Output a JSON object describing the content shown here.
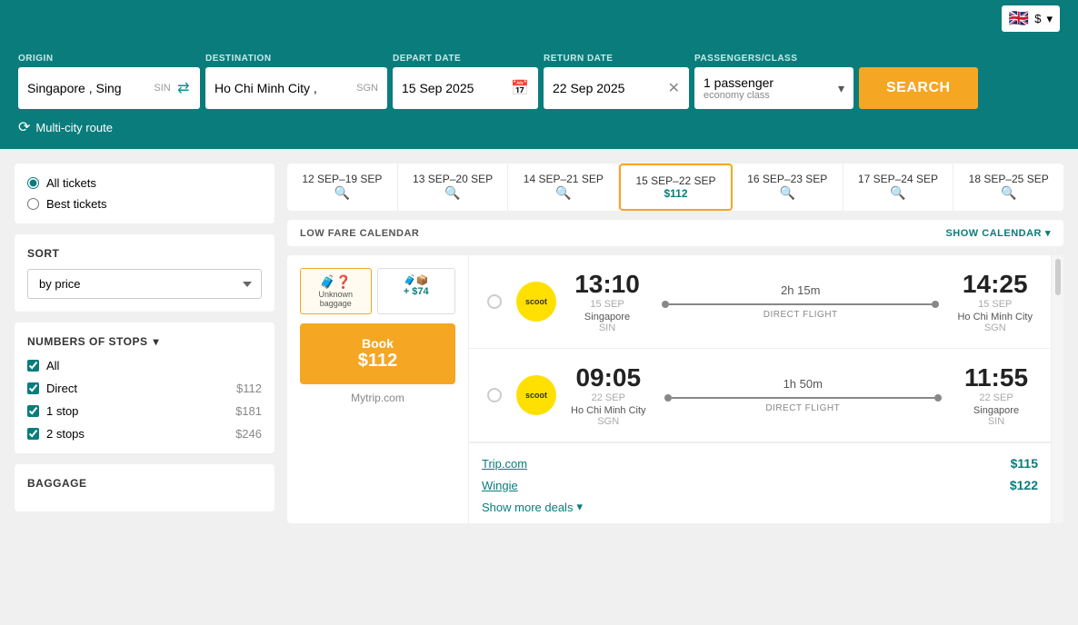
{
  "topbar": {
    "flag": "🇬🇧",
    "currency": "$",
    "chevron": "▾"
  },
  "search": {
    "origin_label": "ORIGIN",
    "origin_city": "Singapore , Sing",
    "origin_code": "SIN",
    "swap_icon": "⇄",
    "dest_label": "DESTINATION",
    "dest_city": "Ho Chi Minh City ,",
    "dest_code": "SGN",
    "depart_label": "DEPART DATE",
    "depart_value": "15 Sep 2025",
    "return_label": "RETURN DATE",
    "return_value": "22 Sep 2025",
    "pass_label": "PASSENGERS/CLASS",
    "passengers": "1 passenger",
    "class": "economy class",
    "search_btn": "SEARCH",
    "multi_city": "Multi-city route"
  },
  "sidebar": {
    "ticket_types": [
      {
        "id": "all",
        "label": "All tickets",
        "checked": true
      },
      {
        "id": "best",
        "label": "Best tickets",
        "checked": false
      }
    ],
    "sort": {
      "label": "SORT",
      "value": "by price"
    },
    "stops": {
      "label": "NUMBERS OF STOPS",
      "chevron": "▾",
      "items": [
        {
          "label": "All",
          "price": "",
          "checked": true
        },
        {
          "label": "Direct",
          "price": "$112",
          "checked": true
        },
        {
          "label": "1 stop",
          "price": "$181",
          "checked": true
        },
        {
          "label": "2 stops",
          "price": "$246",
          "checked": true
        }
      ]
    },
    "baggage_label": "BAGGAGE"
  },
  "date_tabs": [
    {
      "range": "12 SEP–19 SEP",
      "price": "",
      "active": false
    },
    {
      "range": "13 SEP–20 SEP",
      "price": "",
      "active": false
    },
    {
      "range": "14 SEP–21 SEP",
      "price": "",
      "active": false
    },
    {
      "range": "15 SEP–22 SEP",
      "price": "$112",
      "active": true
    },
    {
      "range": "16 SEP–23 SEP",
      "price": "",
      "active": false
    },
    {
      "range": "17 SEP–24 SEP",
      "price": "",
      "active": false
    },
    {
      "range": "18 SEP–25 SEP",
      "price": "",
      "active": false
    }
  ],
  "low_fare": {
    "label": "LOW FARE CALENDAR",
    "show_calendar": "SHOW CALENDAR"
  },
  "flight_card": {
    "baggage_opts": [
      {
        "icons": "🧳❓",
        "label": "Unknown baggage",
        "selected": true
      },
      {
        "icons": "🧳📦",
        "extra": "+ $74",
        "selected": false
      }
    ],
    "book_label": "Book",
    "book_price": "$112",
    "source": "Mytrip.com",
    "segments": [
      {
        "dep_time": "13:10",
        "dep_date": "15",
        "dep_month": "SEP",
        "dep_city": "Singapore",
        "dep_code": "SIN",
        "duration": "2h 15m",
        "direct_label": "DIRECT FLIGHT",
        "arr_time": "14:25",
        "arr_date": "15",
        "arr_month": "SEP",
        "arr_city": "Ho Chi Minh City",
        "arr_code": "SGN"
      },
      {
        "dep_time": "09:05",
        "dep_date": "22",
        "dep_month": "SEP",
        "dep_city": "Ho Chi Minh City",
        "dep_code": "SGN",
        "duration": "1h 50m",
        "direct_label": "DIRECT FLIGHT",
        "arr_time": "11:55",
        "arr_date": "22",
        "arr_month": "SEP",
        "arr_city": "Singapore",
        "arr_code": "SIN"
      }
    ],
    "deals": [
      {
        "source": "Trip.com",
        "price": "$115"
      },
      {
        "source": "Wingie",
        "price": "$122"
      }
    ],
    "show_more": "Show more deals"
  }
}
